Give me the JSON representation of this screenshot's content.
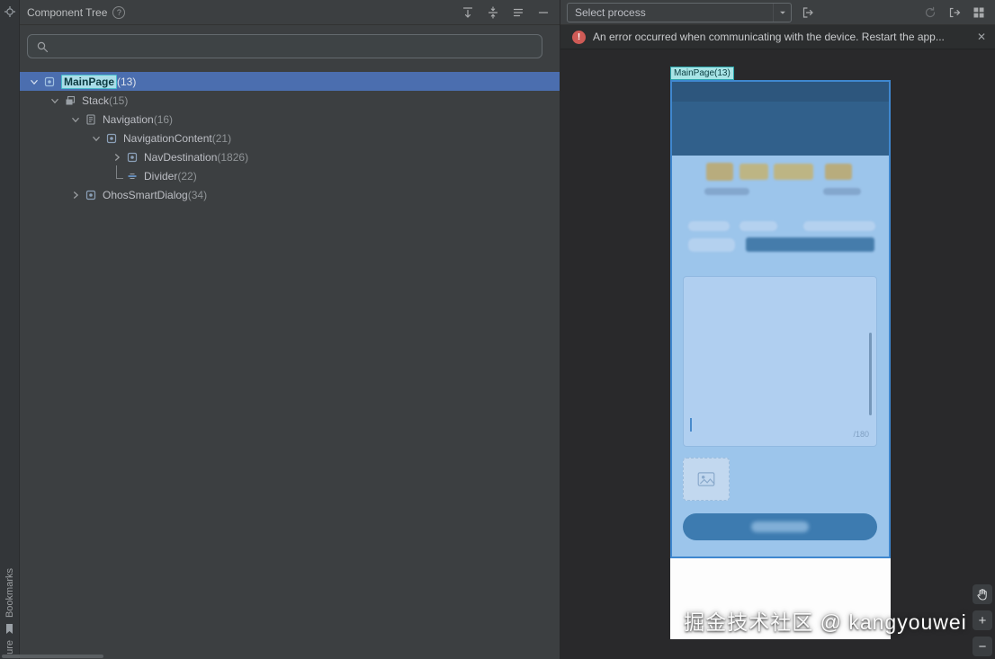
{
  "strip": {
    "bookmarks_label": "Bookmarks",
    "structure_label": "ture"
  },
  "tree_panel": {
    "title": "Component Tree",
    "help_glyph": "?",
    "toolbar_icons": [
      "expand-all",
      "collapse-all",
      "view-options",
      "hide"
    ],
    "search": {
      "placeholder": ""
    },
    "nodes": [
      {
        "label": "MainPage",
        "suffix": "(13)",
        "icon": "component",
        "depth": 0,
        "state": "expanded",
        "selected": true,
        "match": true
      },
      {
        "label": "Stack",
        "suffix": "(15)",
        "icon": "stack",
        "depth": 1,
        "state": "expanded"
      },
      {
        "label": "Navigation",
        "suffix": "(16)",
        "icon": "navigation",
        "depth": 2,
        "state": "expanded"
      },
      {
        "label": "NavigationContent",
        "suffix": "(21)",
        "icon": "component",
        "depth": 3,
        "state": "expanded"
      },
      {
        "label": "NavDestination",
        "suffix": "(1826)",
        "icon": "component",
        "depth": 4,
        "state": "collapsed"
      },
      {
        "label": "Divider",
        "suffix": "(22)",
        "icon": "divider",
        "depth": 4,
        "state": "leaf"
      },
      {
        "label": "OhosSmartDialog",
        "suffix": "(34)",
        "icon": "component",
        "depth": 2,
        "state": "collapsed"
      }
    ]
  },
  "device_panel": {
    "process_selector": {
      "value": "Select process"
    },
    "error": {
      "message": "An error occurred when communicating with the device. Restart the app...",
      "close_glyph": "✕"
    },
    "inspector": {
      "component_label": "MainPage(13)",
      "char_counter": "/180"
    },
    "watermark": "掘金技术社区 @ kangyouwei",
    "zoom": {
      "plus_glyph": "+",
      "minus_glyph": "−"
    }
  },
  "colors": {
    "selection_blue": "#4b6eaf",
    "match_cyan": "#a9dde8",
    "error_red": "#cf5b56",
    "overlay_blue": "#3f87cf",
    "label_cyan_bg": "#a8e4e6"
  }
}
